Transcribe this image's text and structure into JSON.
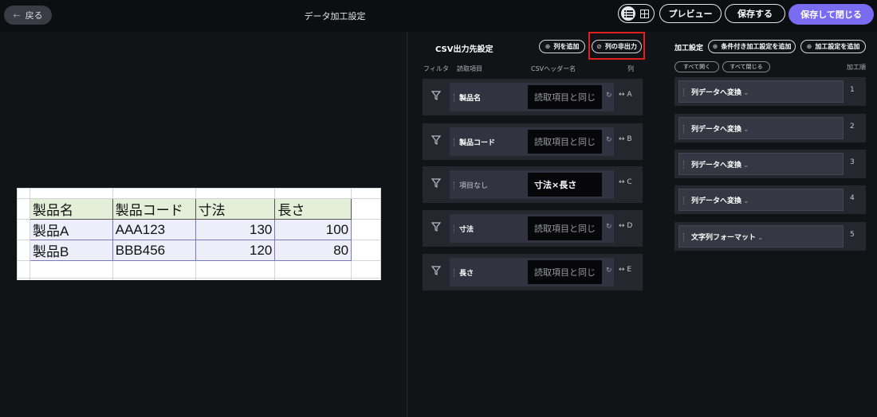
{
  "header": {
    "back_label": "戻る",
    "back_icon": "arrow-left-icon",
    "title": "データ加工設定",
    "view_toggle": {
      "list_icon": "list-icon",
      "grid_icon": "grid-icon",
      "active": "list"
    },
    "preview_label": "プレビュー",
    "save_label": "保存する",
    "save_close_label": "保存して閉じる"
  },
  "sheet": {
    "rows": [
      [
        "製品名",
        "製品コード",
        "寸法",
        "長さ"
      ],
      [
        "製品A",
        "AAA123",
        "130",
        "100"
      ],
      [
        "製品B",
        "BBB456",
        "120",
        "80"
      ]
    ]
  },
  "csv_output": {
    "title": "CSV出力先設定",
    "add_column_label": "列を追加",
    "hide_column_label": "列の非出力",
    "headers": {
      "filter": "フィルタ",
      "source": "読取項目",
      "csv_header": "CSVヘッダー名",
      "column": "列"
    },
    "rows": [
      {
        "source": "製品名",
        "header_value": "読取項目と同じ",
        "column": "A",
        "has_reset": true,
        "dim": false
      },
      {
        "source": "製品コード",
        "header_value": "読取項目と同じ",
        "column": "B",
        "has_reset": true,
        "dim": false
      },
      {
        "source": "項目なし",
        "header_value": "寸法×長さ",
        "column": "C",
        "has_reset": false,
        "dim": true
      },
      {
        "source": "寸法",
        "header_value": "読取項目と同じ",
        "column": "D",
        "has_reset": true,
        "dim": false
      },
      {
        "source": "長さ",
        "header_value": "読取項目と同じ",
        "column": "E",
        "has_reset": true,
        "dim": false
      }
    ]
  },
  "processing": {
    "title": "加工設定",
    "add_conditional_label": "条件付き加工設定を追加",
    "add_processing_label": "加工設定を追加",
    "expand_all_label": "すべて開く",
    "collapse_all_label": "すべて閉じる",
    "order_label": "加工順",
    "items": [
      {
        "label": "列データへ変換",
        "order": "1"
      },
      {
        "label": "列データへ変換",
        "order": "2"
      },
      {
        "label": "列データへ変換",
        "order": "3"
      },
      {
        "label": "列データへ変換",
        "order": "4"
      },
      {
        "label": "文字列フォーマット",
        "order": "5"
      }
    ]
  },
  "colors": {
    "accent": "#7a6cf0",
    "highlight": "#e0201c",
    "background": "#121317"
  }
}
